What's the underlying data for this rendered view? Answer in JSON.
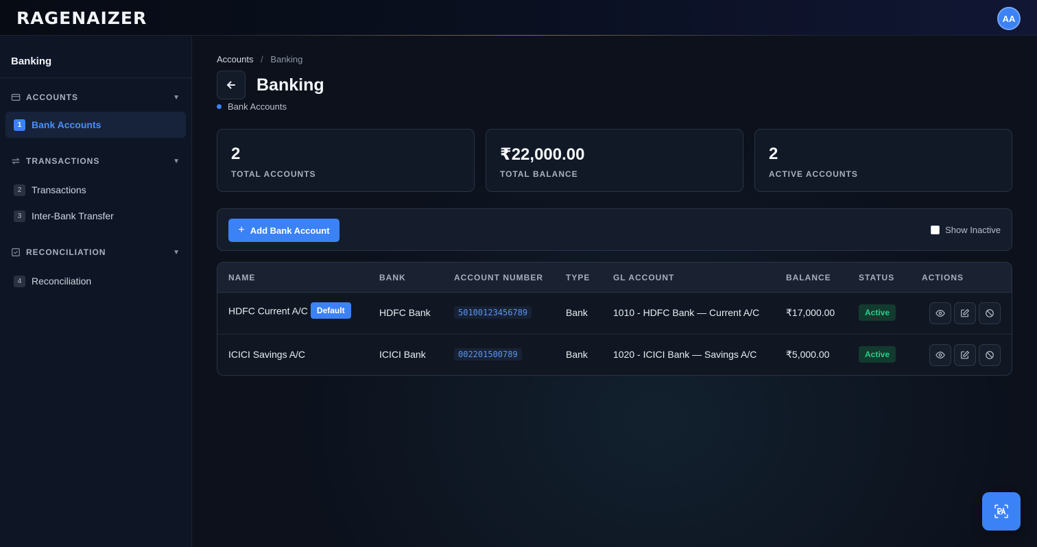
{
  "app": {
    "logo": "RAGENAIZER",
    "user_initials": "AA"
  },
  "sidebar": {
    "title": "Banking",
    "sections": [
      {
        "label": "ACCOUNTS",
        "icon": "credit-card-icon",
        "items": [
          {
            "num": "1",
            "label": "Bank Accounts",
            "active": true
          }
        ]
      },
      {
        "label": "TRANSACTIONS",
        "icon": "transfer-arrows-icon",
        "items": [
          {
            "num": "2",
            "label": "Transactions"
          },
          {
            "num": "3",
            "label": "Inter-Bank Transfer"
          }
        ]
      },
      {
        "label": "RECONCILIATION",
        "icon": "checkbox-icon",
        "items": [
          {
            "num": "4",
            "label": "Reconciliation"
          }
        ]
      }
    ]
  },
  "breadcrumb": {
    "first": "Accounts",
    "separator": "/",
    "current": "Banking"
  },
  "page": {
    "title": "Banking",
    "subtitle": "Bank Accounts"
  },
  "stats": [
    {
      "value": "2",
      "label": "TOTAL ACCOUNTS"
    },
    {
      "value": "₹22,000.00",
      "label": "TOTAL BALANCE"
    },
    {
      "value": "2",
      "label": "ACTIVE ACCOUNTS"
    }
  ],
  "toolbar": {
    "add_label": "Add Bank Account",
    "show_inactive_label": "Show Inactive",
    "show_inactive_checked": false
  },
  "table": {
    "headers": {
      "name": "NAME",
      "bank": "BANK",
      "account_number": "ACCOUNT NUMBER",
      "type": "TYPE",
      "gl_account": "GL ACCOUNT",
      "balance": "BALANCE",
      "status": "STATUS",
      "actions": "ACTIONS"
    },
    "rows": [
      {
        "name": "HDFC Current A/C",
        "badge": "Default",
        "bank": "HDFC Bank",
        "account_number": "50100123456789",
        "type": "Bank",
        "gl_account": "1010 - HDFC Bank — Current A/C",
        "balance": "₹17,000.00",
        "status": "Active"
      },
      {
        "name": "ICICI Savings A/C",
        "badge": "",
        "bank": "ICICI Bank",
        "account_number": "002201500789",
        "type": "Bank",
        "gl_account": "1020 - ICICI Bank — Savings A/C",
        "balance": "₹5,000.00",
        "status": "Active"
      }
    ]
  },
  "colors": {
    "accent": "#3b82f6",
    "status_active_bg": "#123a2e",
    "status_active_text": "#2ecc8b"
  },
  "fab": {
    "icon": "assistant-icon"
  }
}
